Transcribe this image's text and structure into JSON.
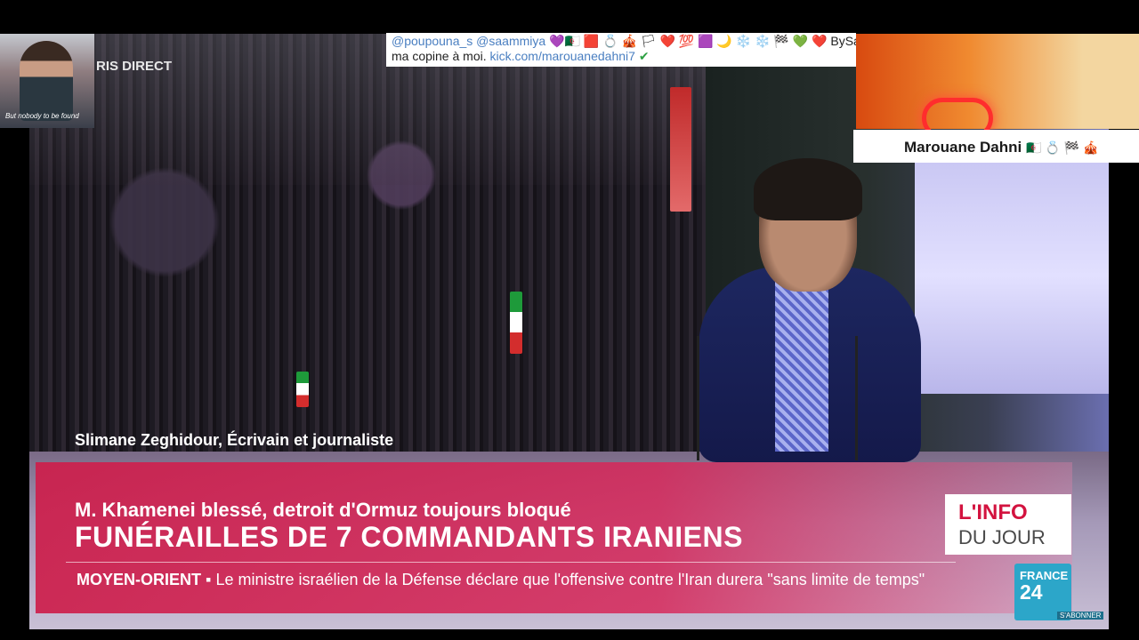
{
  "broadcast": {
    "channel_logo": "RIS   DIRECT",
    "guest_caption": "Slimane Zeghidour, Écrivain et journaliste",
    "subtitle": "M. Khamenei blessé, detroit d'Ormuz toujours bloqué",
    "headline": "FUNÉRAILLES DE 7 COMMANDANTS IRANIENS",
    "ticker_label": "MOYEN-ORIENT",
    "ticker_bullet": "▪",
    "ticker_text": "Le ministre israélien de la Défense déclare que l'offensive contre l'Iran durera \"sans limite de temps\"",
    "show_title": "L'INFO",
    "show_subtitle": "DU JOUR",
    "network_top": "FRANCE",
    "network_num": "24",
    "subscribe_label": "S'ABONNER"
  },
  "overlays": {
    "webcam_caption": "But nobody to be found",
    "chat_line1_prefix": "@poupouna_s  @saammiya",
    "chat_line1_emojis": "💜🇩🇿 🟥 💍 🎪 🏳 ❤️ 💯 🟪 🌙 ❄️ ❄️ 🏁 💚 ❤️",
    "chat_line1_suffix": "BySam C",
    "chat_line2_prefix": "ma copine à moi.",
    "chat_line2_link": "kick.com/marouanedahni7",
    "chat_line2_check": "✔",
    "name_bar_text": "Marouane Dahni",
    "name_bar_emojis": "🇩🇿 💍 🏁 🎪"
  },
  "colors": {
    "accent_red": "#d3133f",
    "band_pink": "#cd1e4b",
    "france24_blue": "#2ca6c9"
  }
}
